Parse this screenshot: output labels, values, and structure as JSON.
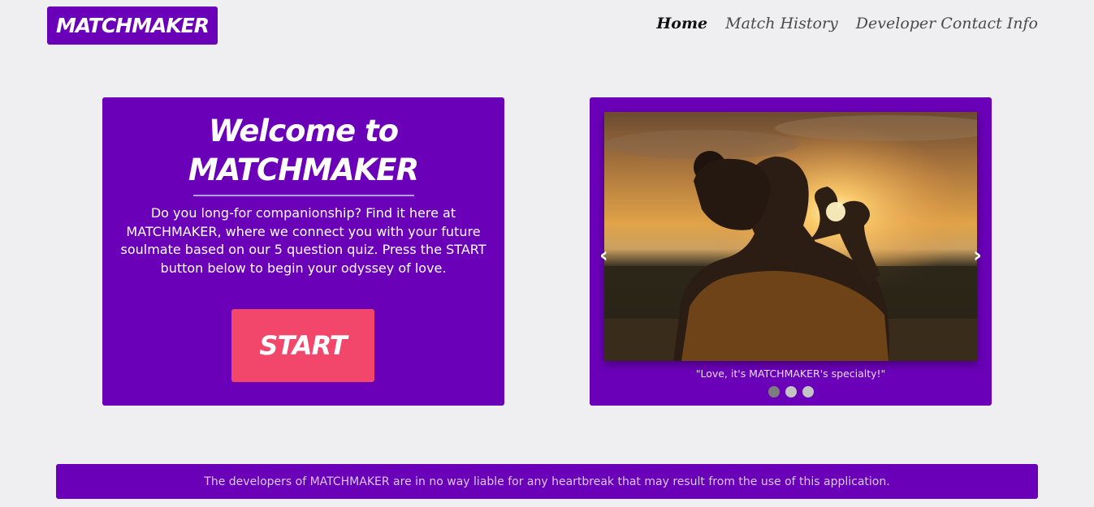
{
  "brand": {
    "logo_text": "MATCHMAKER"
  },
  "nav": {
    "items": [
      {
        "label": "Home"
      },
      {
        "label": "Match History"
      },
      {
        "label": "Developer Contact Info"
      }
    ]
  },
  "welcome": {
    "title_line1": "Welcome to",
    "title_line2": "MATCHMAKER",
    "description": "Do you long-for companionship? Find it here at MATCHMAKER, where we connect you with your future soulmate based on our 5 question quiz. Press the START button below to begin your odyssey of love.",
    "start_label": "START"
  },
  "carousel": {
    "prev_icon": "‹",
    "next_icon": "›",
    "caption": "\"Love, it's MATCHMAKER's specialty!\"",
    "slide_count": 3,
    "active_slide": 1,
    "image_subject": "woman making heart shape with hands at sunset"
  },
  "footer": {
    "disclaimer": "The developers of MATCHMAKER are in no way liable for any heartbreak that may result from the use of this application."
  },
  "colors": {
    "brand_purple": "#6a00b8",
    "start_pink": "#f2466a",
    "page_bg": "#efeff1"
  }
}
